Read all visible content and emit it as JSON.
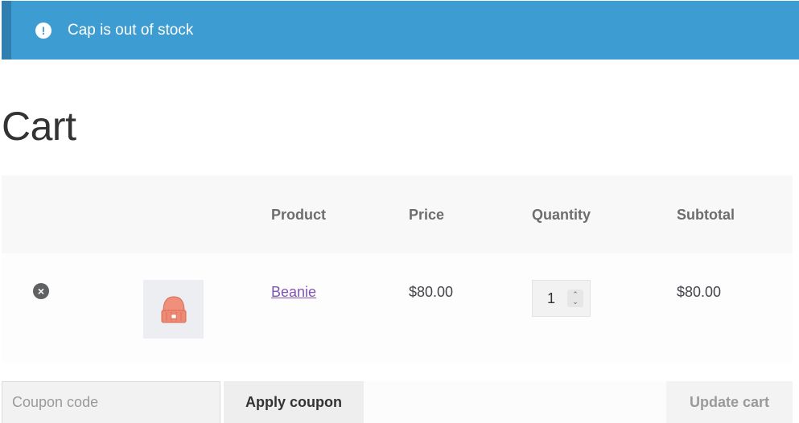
{
  "notice": {
    "icon": "exclamation-circle-icon",
    "text": "Cap is out of stock",
    "color": "#3d9cd2"
  },
  "page": {
    "title": "Cart"
  },
  "table": {
    "headers": {
      "product": "Product",
      "price": "Price",
      "quantity": "Quantity",
      "subtotal": "Subtotal"
    },
    "rows": [
      {
        "remove_icon": "remove-circle-icon",
        "thumbnail_icon": "beanie-icon",
        "product": "Beanie",
        "price": "$80.00",
        "quantity": "1",
        "subtotal": "$80.00"
      }
    ]
  },
  "actions": {
    "coupon_placeholder": "Coupon code",
    "apply_label": "Apply coupon",
    "update_label": "Update cart"
  }
}
